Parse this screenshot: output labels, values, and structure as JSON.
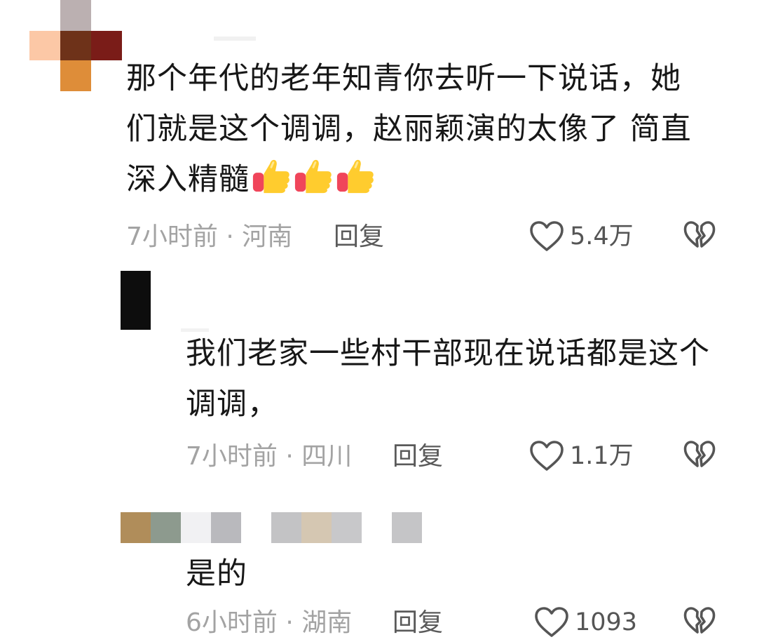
{
  "comments": [
    {
      "text": "那个年代的老年知青你去听一下说话，她\n们就是这个调调，赵丽颖演的太像了 简直\n深入精髓",
      "emoji": "thumbs-up x3",
      "time": "7小时前",
      "location": "河南",
      "meta_sep": " · ",
      "reply_label": "回复",
      "likes": "5.4万"
    },
    {
      "text": "我们老家一些村干部现在说话都是这个\n调调，",
      "time": "7小时前",
      "location": "四川",
      "meta_sep": " · ",
      "reply_label": "回复",
      "likes": "1.1万"
    },
    {
      "text": "是的",
      "time": "6小时前",
      "location": "湖南",
      "meta_sep": " · ",
      "reply_label": "回复",
      "likes": "1093"
    }
  ],
  "icons": {
    "like": "heart-outline-icon",
    "dislike": "broken-heart-icon",
    "emoji": "thumbs-up-emoji-icon"
  },
  "colors": {
    "text": "#171717",
    "meta": "#a3a3a3",
    "reply": "#5a5a5a",
    "icon": "#555555"
  }
}
